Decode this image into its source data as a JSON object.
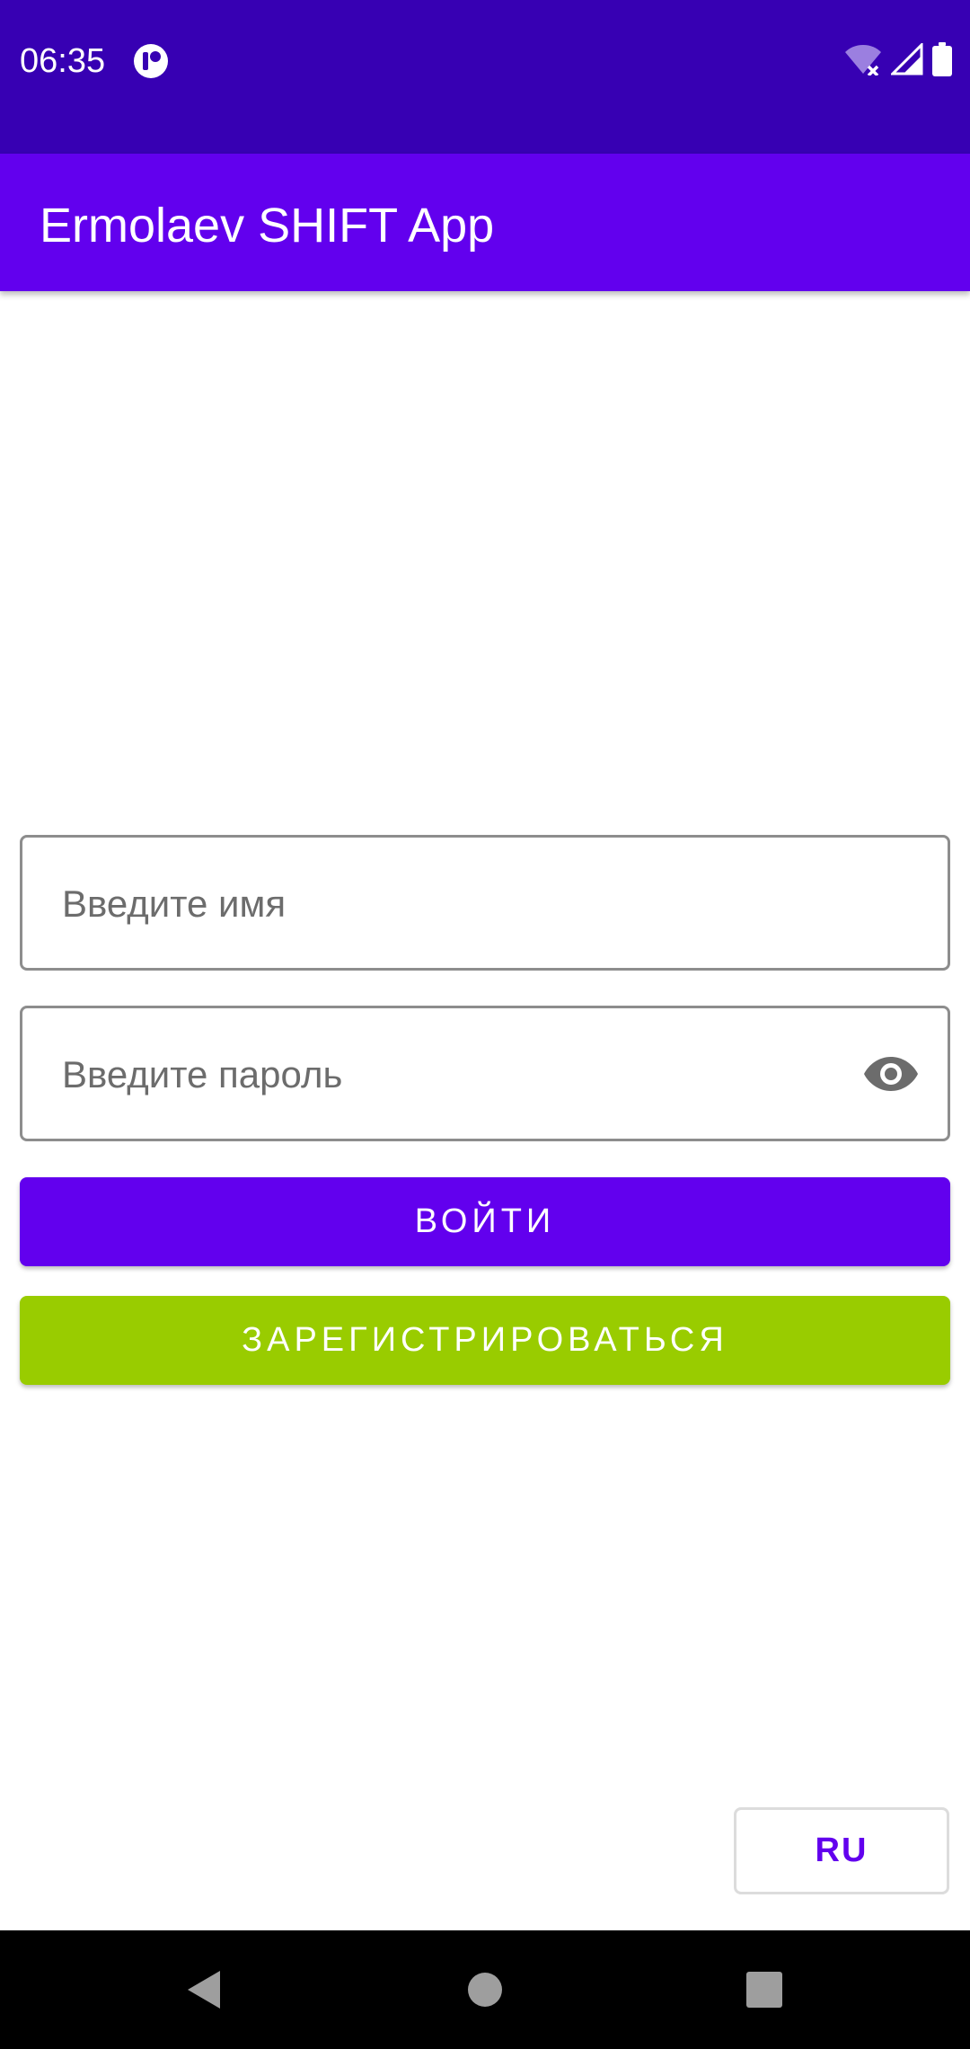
{
  "status_bar": {
    "time": "06:35",
    "icons": [
      "app-notification-icon",
      "wifi-off-icon",
      "signal-icon",
      "battery-icon"
    ]
  },
  "app_bar": {
    "title": "Ermolaev SHIFT App"
  },
  "login_form": {
    "name_placeholder": "Введите имя",
    "name_value": "",
    "password_placeholder": "Введите пароль",
    "password_value": "",
    "password_toggle_icon": "eye-icon",
    "login_label": "ВОЙТИ",
    "register_label": "ЗАРЕГИСТРИРОВАТЬСЯ"
  },
  "language": {
    "label": "RU"
  },
  "nav_bar": {
    "icons": [
      "back-icon",
      "home-icon",
      "recents-icon"
    ]
  },
  "colors": {
    "status_bar": "#3700b3",
    "primary": "#6200ee",
    "register_button": "#99cc00",
    "nav_bar": "#000000"
  }
}
